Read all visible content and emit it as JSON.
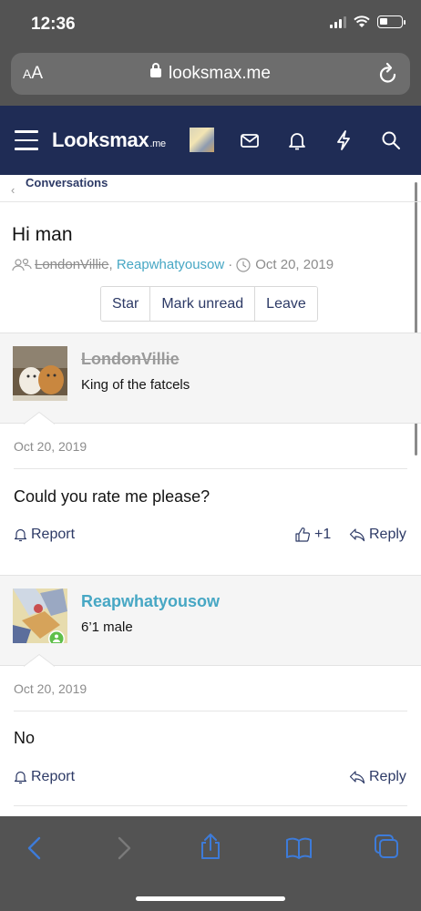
{
  "status_bar": {
    "time": "12:36"
  },
  "browser": {
    "text_size_label": "AA",
    "url": "looksmax.me"
  },
  "navbar": {
    "logo": "Looksmax",
    "logo_suffix": ".me"
  },
  "breadcrumb": {
    "label": "Conversations"
  },
  "conversation": {
    "title": "Hi man",
    "participant_1": "LondonVillie",
    "participant_2": "Reapwhatyousow",
    "date": "Oct 20, 2019",
    "buttons": {
      "star": "Star",
      "mark_unread": "Mark unread",
      "leave": "Leave"
    }
  },
  "messages": [
    {
      "author": "LondonVillie",
      "user_title": "King of the fatcels",
      "date": "Oct 20, 2019",
      "body": "Could you rate me please?",
      "report_label": "Report",
      "reaction_count": "+1",
      "reply_label": "Reply"
    },
    {
      "author": "Reapwhatyousow",
      "user_title": "6’1 male",
      "date": "Oct 20, 2019",
      "body": "No",
      "report_label": "Report",
      "reply_label": "Reply"
    }
  ],
  "colors": {
    "navbar": "#1f2c55",
    "link": "#47a7c4",
    "action_text": "#2d3a66",
    "ios_chrome": "#535353",
    "ios_accent": "#3d7bd9"
  }
}
